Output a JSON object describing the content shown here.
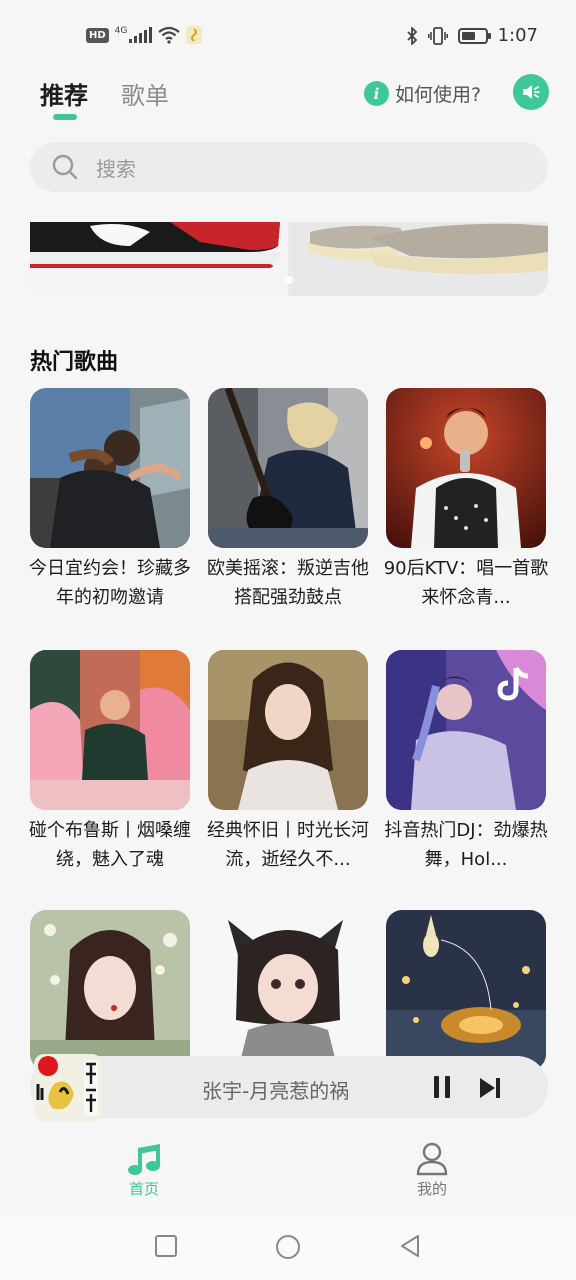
{
  "status_bar": {
    "hd": "HD",
    "network": "4G",
    "time": "1:07",
    "battery_level": 0.6
  },
  "header": {
    "tabs": [
      {
        "label": "推荐",
        "active": true
      },
      {
        "label": "歌单",
        "active": false
      }
    ],
    "help_label": "如何使用?",
    "accent_color": "#3ec89a"
  },
  "search": {
    "placeholder": "搜索"
  },
  "section": {
    "title": "热门歌曲"
  },
  "songs": [
    {
      "title": "今日宜约会！珍藏多年的初吻邀请"
    },
    {
      "title": "欧美摇滚：叛逆吉他搭配强劲鼓点"
    },
    {
      "title": "90后KTV：唱一首歌来怀念青..."
    },
    {
      "title": "碰个布鲁斯丨烟嗓缠绕，魅入了魂"
    },
    {
      "title": "经典怀旧丨时光长河流，逝经久不..."
    },
    {
      "title": "抖音热门DJ：劲爆热舞，Hol..."
    },
    {
      "title": ""
    },
    {
      "title": ""
    },
    {
      "title": ""
    }
  ],
  "player": {
    "now_playing": "张宇-月亮惹的祸"
  },
  "bottom_nav": {
    "home_label": "首页",
    "mine_label": "我的"
  }
}
